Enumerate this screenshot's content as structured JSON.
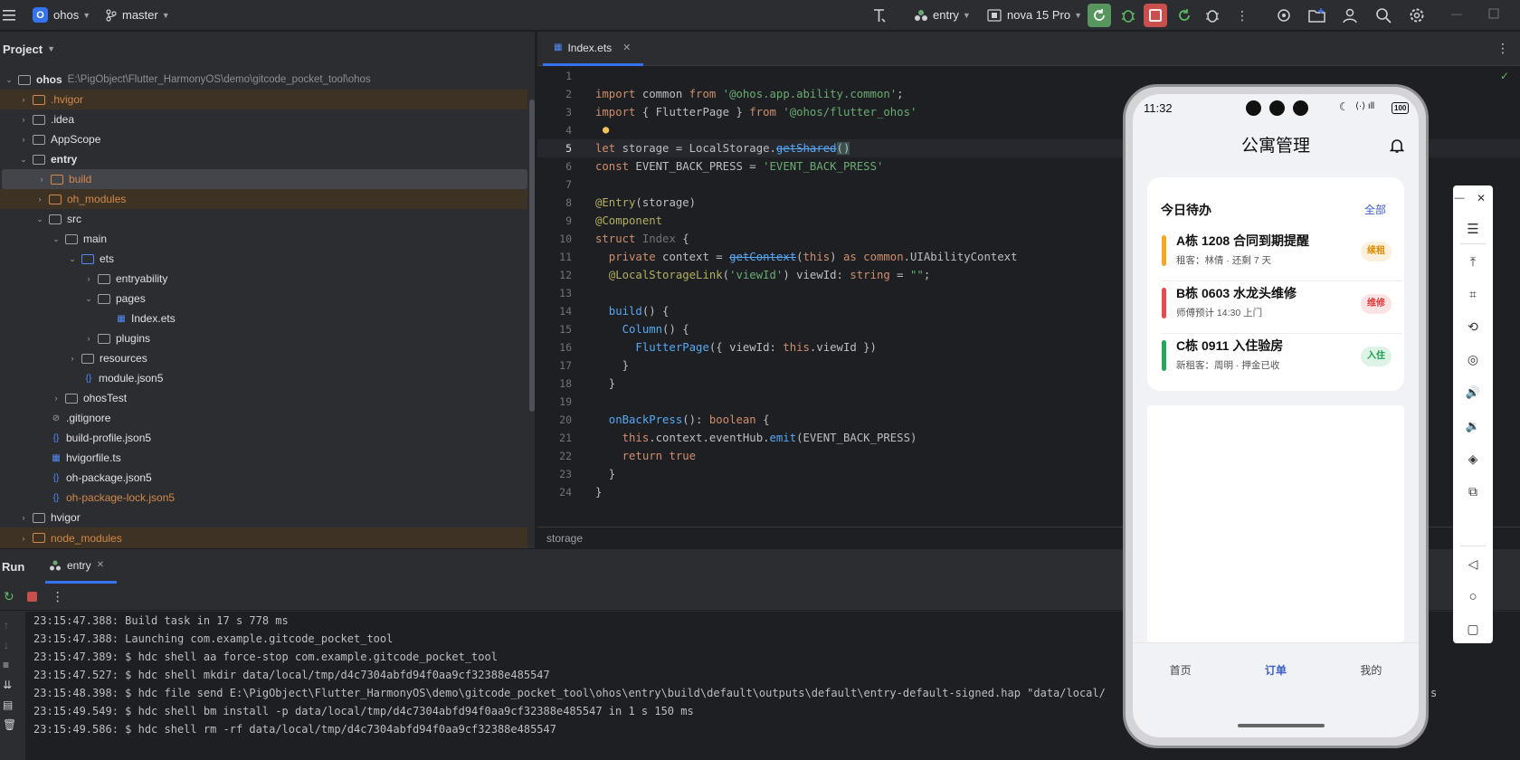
{
  "topbar": {
    "project_badge": "O",
    "project_name": "ohos",
    "branch": "master",
    "run_config": "entry",
    "device": "nova 15 Pro"
  },
  "project_panel": {
    "title": "Project",
    "root_name": "ohos",
    "root_path": "E:\\PigObject\\Flutter_HarmonyOS\\demo\\gitcode_pocket_tool\\ohos",
    "items": [
      {
        "label": ".hvigor"
      },
      {
        "label": ".idea"
      },
      {
        "label": "AppScope"
      },
      {
        "label": "entry"
      },
      {
        "label": "build"
      },
      {
        "label": "oh_modules"
      },
      {
        "label": "src"
      },
      {
        "label": "main"
      },
      {
        "label": "ets"
      },
      {
        "label": "entryability"
      },
      {
        "label": "pages"
      },
      {
        "label": "Index.ets"
      },
      {
        "label": "plugins"
      },
      {
        "label": "resources"
      },
      {
        "label": "module.json5"
      },
      {
        "label": "ohosTest"
      },
      {
        "label": ".gitignore"
      },
      {
        "label": "build-profile.json5"
      },
      {
        "label": "hvigorfile.ts"
      },
      {
        "label": "oh-package.json5"
      },
      {
        "label": "oh-package-lock.json5"
      },
      {
        "label": "hvigor"
      },
      {
        "label": "node_modules"
      }
    ]
  },
  "editor": {
    "tab": "Index.ets",
    "current_line": "5",
    "breadcrumb": "storage",
    "line_numbers": [
      "1",
      "2",
      "3",
      "4",
      "5",
      "6",
      "7",
      "8",
      "9",
      "10",
      "11",
      "12",
      "13",
      "14",
      "15",
      "16",
      "17",
      "18",
      "19",
      "20",
      "21",
      "22",
      "23",
      "24"
    ],
    "code": {
      "l2_a": "import",
      "l2_b": " common ",
      "l2_c": "from",
      "l2_d": " '@ohos.app.ability.common'",
      "l2_e": ";",
      "l3_a": "import",
      "l3_b": " { FlutterPage } ",
      "l3_c": "from",
      "l3_d": " '@ohos/flutter_ohos'",
      "l5_a": "let",
      "l5_b": " storage = LocalStorage.",
      "l5_c": "getShared",
      "l5_d": "()",
      "l6_a": "const",
      "l6_b": " EVENT_BACK_PRESS = ",
      "l6_c": "'EVENT_BACK_PRESS'",
      "l8_a": "@Entry",
      "l8_b": "(storage)",
      "l9_a": "@Component",
      "l10_a": "struct",
      "l10_b": " Index ",
      "l10_c": "{",
      "l11_a": "  private",
      "l11_b": " context = ",
      "l11_c": "getContext",
      "l11_d": "(",
      "l11_e": "this",
      "l11_f": ") ",
      "l11_g": "as",
      "l11_h": " common",
      "l11_i": ".UIAbilityContext",
      "l12_a": "  @LocalStorageLink",
      "l12_b": "(",
      "l12_c": "'viewId'",
      "l12_d": ") viewId: ",
      "l12_e": "string",
      "l12_f": " = ",
      "l12_g": "\"\"",
      "l12_h": ";",
      "l14_a": "  build",
      "l14_b": "() {",
      "l15_a": "    Column",
      "l15_b": "() {",
      "l16_a": "      FlutterPage",
      "l16_b": "({ viewId: ",
      "l16_c": "this",
      "l16_d": ".viewId })",
      "l17_a": "    }",
      "l18_a": "  }",
      "l20_a": "  onBackPress",
      "l20_b": "(): ",
      "l20_c": "boolean",
      "l20_d": " {",
      "l21_a": "    this",
      "l21_b": ".context.eventHub.",
      "l21_c": "emit",
      "l21_d": "(EVENT_BACK_PRESS)",
      "l22_a": "    return",
      "l22_b": " true",
      "l23_a": "  }",
      "l24_a": "}"
    }
  },
  "run_panel": {
    "title": "Run",
    "tab": "entry",
    "lines": [
      "23:15:47.388: Build task in 17 s 778 ms",
      "23:15:47.388: Launching com.example.gitcode_pocket_tool",
      "23:15:47.389: $ hdc shell aa force-stop com.example.gitcode_pocket_tool",
      "23:15:47.527: $ hdc shell mkdir data/local/tmp/d4c7304abfd94f0aa9cf32388e485547",
      "23:15:48.398: $ hdc file send E:\\PigObject\\Flutter_HarmonyOS\\demo\\gitcode_pocket_tool\\ohos\\entry\\build\\default\\outputs\\default\\entry-default-signed.hap \"data/local/",
      "23:15:49.549: $ hdc shell bm install -p data/local/tmp/d4c7304abfd94f0aa9cf32388e485547 in 1 s 150 ms",
      "23:15:49.586: $ hdc shell rm -rf data/local/tmp/d4c7304abfd94f0aa9cf32388e485547"
    ],
    "overflow_tail": "s"
  },
  "phone": {
    "time": "11:32",
    "battery": "100",
    "app_title": "公寓管理",
    "card_title": "今日待办",
    "card_link": "全部",
    "todos": [
      {
        "title": "A栋 1208 合同到期提醒",
        "sub": "租客：林倩 · 还剩 7 天",
        "tag": "续租",
        "bar_color": "#f5a623",
        "tag_bg": "#fdf1dc",
        "tag_color": "#e08a00"
      },
      {
        "title": "B栋 0603 水龙头维修",
        "sub": "师傅预计 14:30 上门",
        "tag": "维修",
        "bar_color": "#e84b4b",
        "tag_bg": "#fde3e3",
        "tag_color": "#e03c3c"
      },
      {
        "title": "C栋 0911 入住验房",
        "sub": "新租客：周明 · 押金已收",
        "tag": "入住",
        "bar_color": "#23a55a",
        "tag_bg": "#dcf3e5",
        "tag_color": "#1d9a50"
      }
    ],
    "nav": [
      "首页",
      "订单",
      "我的"
    ],
    "nav_active": "订单"
  },
  "colors": {
    "accent": "#3574f0",
    "editor_bg": "#1e1f22",
    "panel_bg": "#2b2d30"
  }
}
